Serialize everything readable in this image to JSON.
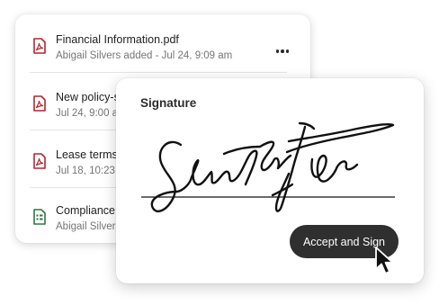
{
  "files": [
    {
      "name": "Financial Information.pdf",
      "meta": "Abigail Silvers added - Jul 24, 9:09 am",
      "icon": "pdf-file-icon"
    },
    {
      "name": "New policy-s",
      "meta": "Jul 24, 9:00 a",
      "icon": "pdf-file-icon"
    },
    {
      "name": "Lease terms",
      "meta": "Jul 18, 10:23 a",
      "icon": "pdf-file-icon"
    },
    {
      "name": "Compliance F",
      "meta": "Abigail Silvers",
      "icon": "form-file-icon"
    }
  ],
  "signature_dialog": {
    "title": "Signature",
    "accept_label": "Accept and Sign"
  },
  "colors": {
    "pdf_icon": "#b3262e",
    "form_icon": "#2c7a3f",
    "button_bg": "#2f2f2f"
  }
}
